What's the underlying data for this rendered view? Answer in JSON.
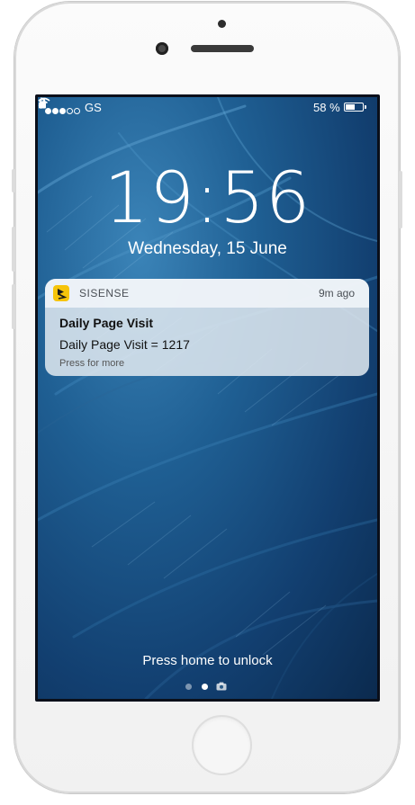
{
  "status_bar": {
    "signal_bars": [
      true,
      true,
      true,
      false,
      false
    ],
    "carrier": "GS",
    "battery_percent_text": "58 %",
    "battery_level": 0.58
  },
  "lock_screen": {
    "time": "19:56",
    "date": "Wednesday, 15 June",
    "unlock_hint": "Press home to unlock",
    "page_indicators": [
      "page",
      "page-active",
      "camera"
    ]
  },
  "notification": {
    "app_name": "SISENSE",
    "timestamp": "9m ago",
    "title": "Daily Page Visit",
    "body": "Daily Page Visit = 1217",
    "action_hint": "Press for more"
  },
  "colors": {
    "app_icon": "#f6c40a",
    "wallpaper_primary": "#1f5f93"
  }
}
